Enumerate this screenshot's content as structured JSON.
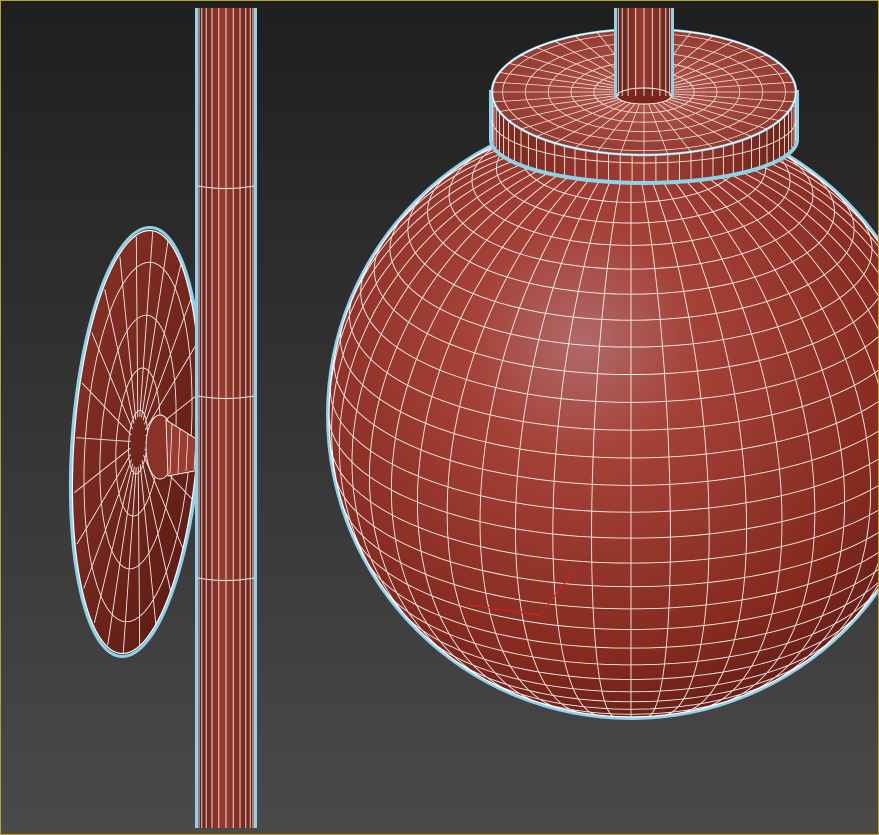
{
  "app": {
    "window_title": ""
  },
  "viewport": {
    "label": "",
    "active_border_color": "#b8a13a",
    "background_top": "#202020",
    "background_bottom": "#484848",
    "mode": "shaded-with-wireframe-edges",
    "selection_highlight": "#8fd3ea"
  },
  "scene_objects": [
    {
      "name": "pole-cylinder",
      "material_color": "#8a2e22",
      "selected": true
    },
    {
      "name": "wall-disc-fixture",
      "material_color": "#7a2a20",
      "selected": true
    },
    {
      "name": "sphere-lamp",
      "material_color": "#a43a2c",
      "selected": true
    },
    {
      "name": "lamp-cap-cylinder",
      "material_color": "#9a3428",
      "selected": true
    },
    {
      "name": "lamp-rod",
      "material_color": "#8a2e22",
      "selected": true
    }
  ],
  "wire_color": "#ffffff"
}
